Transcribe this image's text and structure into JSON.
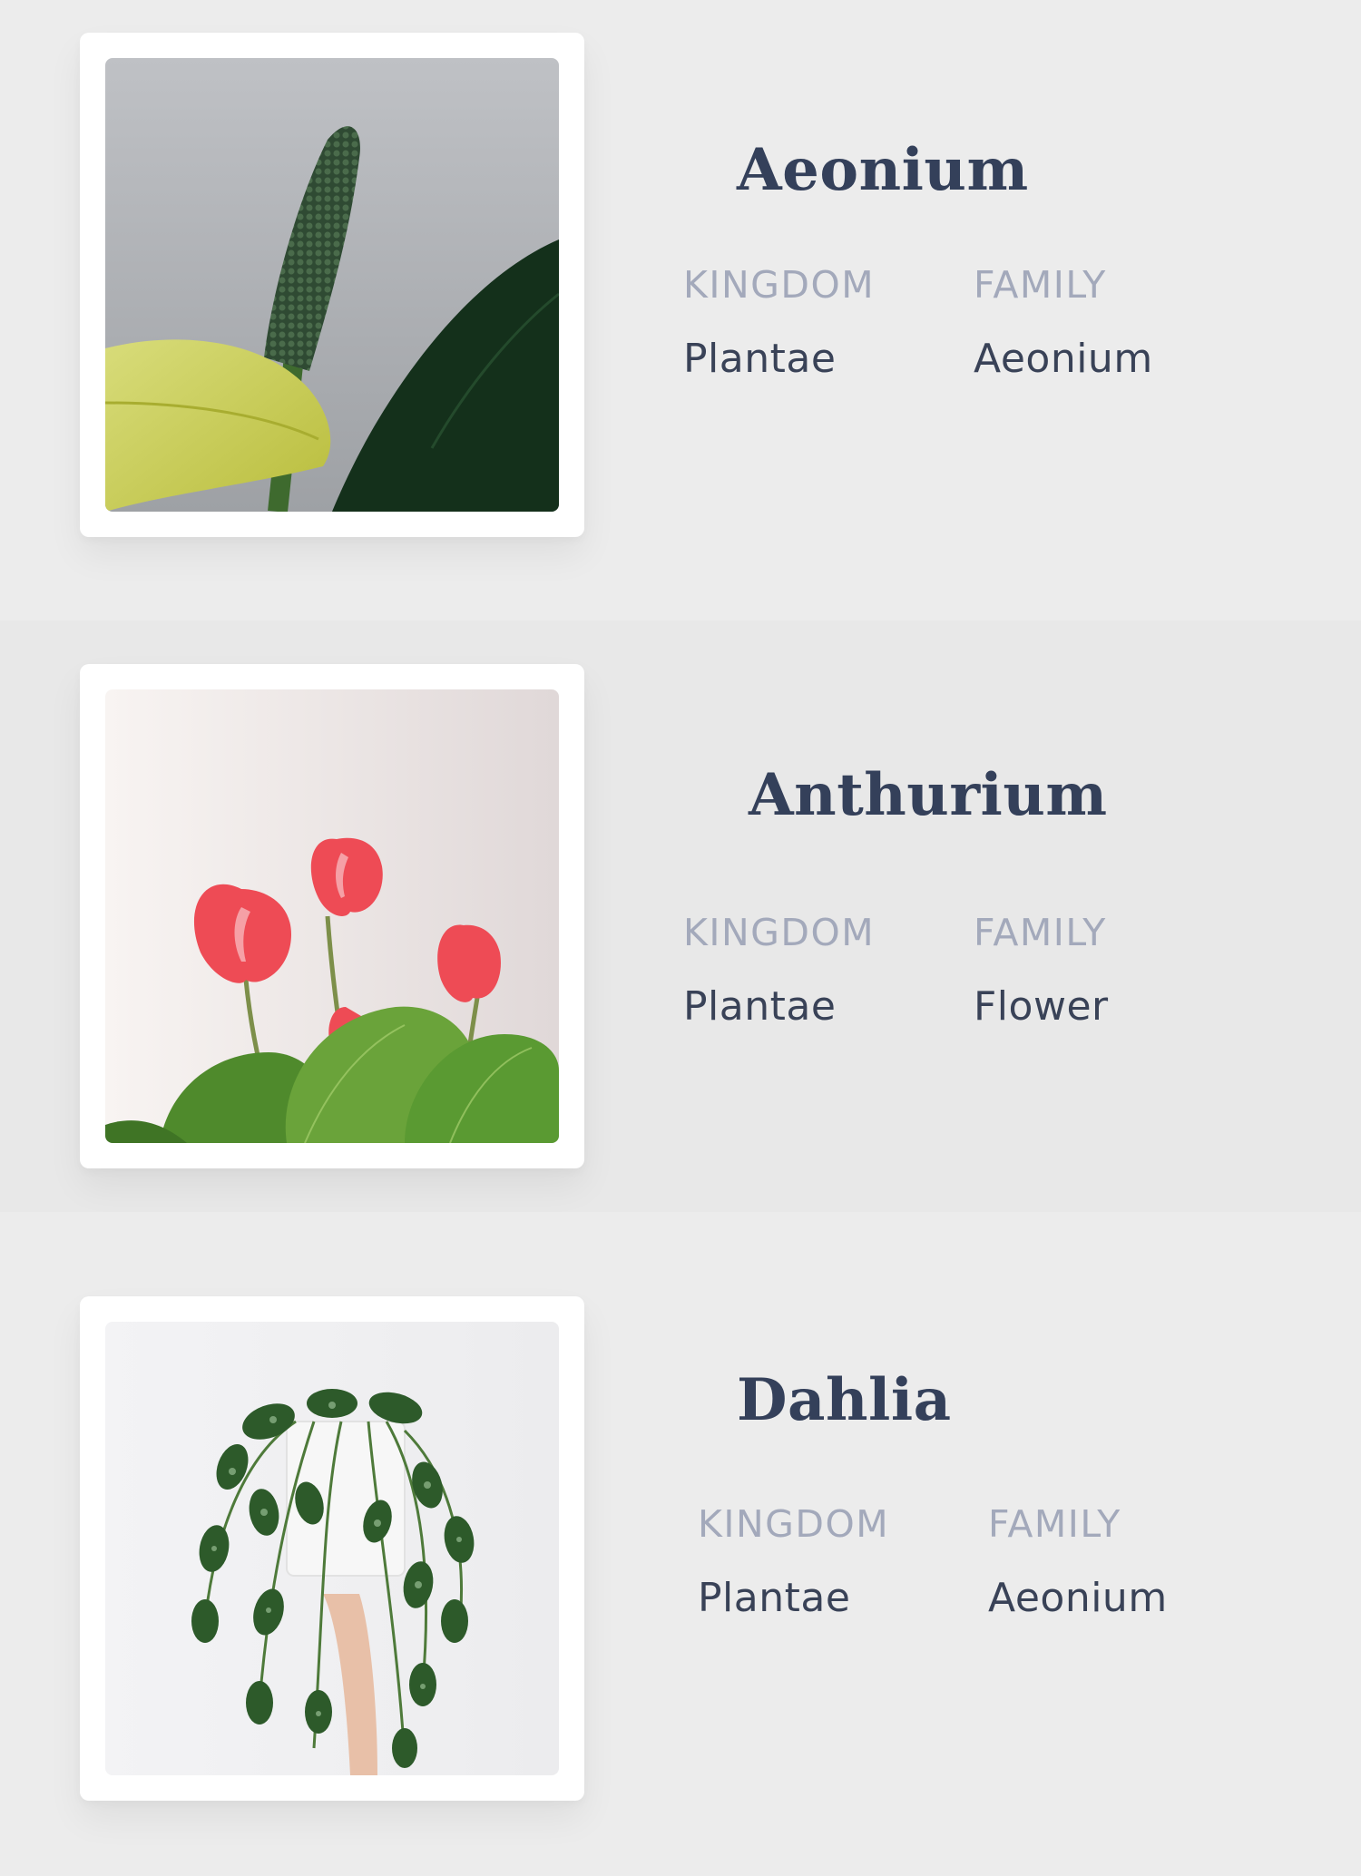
{
  "labels": {
    "kingdom": "KINGDOM",
    "family": "FAMILY"
  },
  "plants": [
    {
      "name": "Aeonium",
      "kingdom": "Plantae",
      "family": "Aeonium",
      "image": "plant-spike-photo"
    },
    {
      "name": "Anthurium",
      "kingdom": "Plantae",
      "family": "Flower",
      "image": "red-anthurium-photo"
    },
    {
      "name": "Dahlia",
      "kingdom": "Plantae",
      "family": "Aeonium",
      "image": "hanging-pothos-photo"
    }
  ],
  "colors": {
    "background": "#ececec",
    "title": "#34405a",
    "label": "#a3a9bb",
    "value": "#394257",
    "card": "#ffffff"
  }
}
